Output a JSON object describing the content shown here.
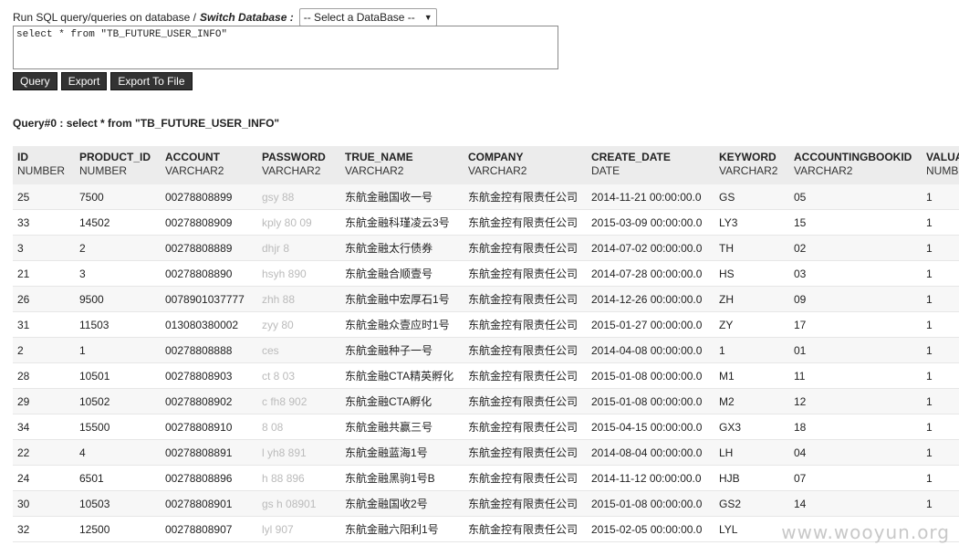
{
  "header": {
    "prefix": "Run SQL query/queries on database /",
    "switch_label": "Switch Database :",
    "db_select_value": "-- Select a DataBase --"
  },
  "sql": {
    "value": "select * from \"TB_FUTURE_USER_INFO\""
  },
  "toolbar": {
    "query_label": "Query",
    "export_label": "Export",
    "export_file_label": "Export To File"
  },
  "result": {
    "title": "Query#0 : select * from \"TB_FUTURE_USER_INFO\""
  },
  "table": {
    "columns": [
      {
        "name": "ID",
        "type": "NUMBER"
      },
      {
        "name": "PRODUCT_ID",
        "type": "NUMBER"
      },
      {
        "name": "ACCOUNT",
        "type": "VARCHAR2"
      },
      {
        "name": "PASSWORD",
        "type": "VARCHAR2"
      },
      {
        "name": "TRUE_NAME",
        "type": "VARCHAR2"
      },
      {
        "name": "COMPANY",
        "type": "VARCHAR2"
      },
      {
        "name": "CREATE_DATE",
        "type": "DATE"
      },
      {
        "name": "KEYWORD",
        "type": "VARCHAR2"
      },
      {
        "name": "ACCOUNTINGBOOKID",
        "type": "VARCHAR2"
      },
      {
        "name": "VALUA",
        "type": "NUMB"
      }
    ],
    "rows": [
      [
        "25",
        "7500",
        "00278808899",
        "gsy 88",
        "东航金融国收一号",
        "东航金控有限责任公司",
        "2014-11-21 00:00:00.0",
        "GS",
        "05",
        "1"
      ],
      [
        "33",
        "14502",
        "00278808909",
        "kply 80 09",
        "东航金融科瑾凌云3号",
        "东航金控有限责任公司",
        "2015-03-09 00:00:00.0",
        "LY3",
        "15",
        "1"
      ],
      [
        "3",
        "2",
        "00278808889",
        "dhjr 8",
        "东航金融太行债券",
        "东航金控有限责任公司",
        "2014-07-02 00:00:00.0",
        "TH",
        "02",
        "1"
      ],
      [
        "21",
        "3",
        "00278808890",
        "hsyh 890",
        "东航金融合顺壹号",
        "东航金控有限责任公司",
        "2014-07-28 00:00:00.0",
        "HS",
        "03",
        "1"
      ],
      [
        "26",
        "9500",
        "0078901037777",
        "zhh 88",
        "东航金融中宏厚石1号",
        "东航金控有限责任公司",
        "2014-12-26 00:00:00.0",
        "ZH",
        "09",
        "1"
      ],
      [
        "31",
        "11503",
        "013080380002",
        "zyy 80",
        "东航金融众壹应时1号",
        "东航金控有限责任公司",
        "2015-01-27 00:00:00.0",
        "ZY",
        "17",
        "1"
      ],
      [
        "2",
        "1",
        "00278808888",
        "ces",
        "东航金融种子一号",
        "东航金控有限责任公司",
        "2014-04-08 00:00:00.0",
        "1",
        "01",
        "1"
      ],
      [
        "28",
        "10501",
        "00278808903",
        "ct 8 03",
        "东航金融CTA精英孵化",
        "东航金控有限责任公司",
        "2015-01-08 00:00:00.0",
        "M1",
        "11",
        "1"
      ],
      [
        "29",
        "10502",
        "00278808902",
        "c fh8 902",
        "东航金融CTA孵化",
        "东航金控有限责任公司",
        "2015-01-08 00:00:00.0",
        "M2",
        "12",
        "1"
      ],
      [
        "34",
        "15500",
        "00278808910",
        "8 08",
        "东航金融共赢三号",
        "东航金控有限责任公司",
        "2015-04-15 00:00:00.0",
        "GX3",
        "18",
        "1"
      ],
      [
        "22",
        "4",
        "00278808891",
        "l yh8 891",
        "东航金融蓝海1号",
        "东航金控有限责任公司",
        "2014-08-04 00:00:00.0",
        "LH",
        "04",
        "1"
      ],
      [
        "24",
        "6501",
        "00278808896",
        "h 88 896",
        "东航金融黑驹1号B",
        "东航金控有限责任公司",
        "2014-11-12 00:00:00.0",
        "HJB",
        "07",
        "1"
      ],
      [
        "30",
        "10503",
        "00278808901",
        "gs h 08901",
        "东航金融国收2号",
        "东航金控有限责任公司",
        "2015-01-08 00:00:00.0",
        "GS2",
        "14",
        "1"
      ],
      [
        "32",
        "12500",
        "00278808907",
        "lyl 907",
        "东航金融六阳利1号",
        "东航金控有限责任公司",
        "2015-02-05 00:00:00.0",
        "LYL",
        "",
        ""
      ]
    ]
  },
  "watermark": "www.wooyun.org"
}
